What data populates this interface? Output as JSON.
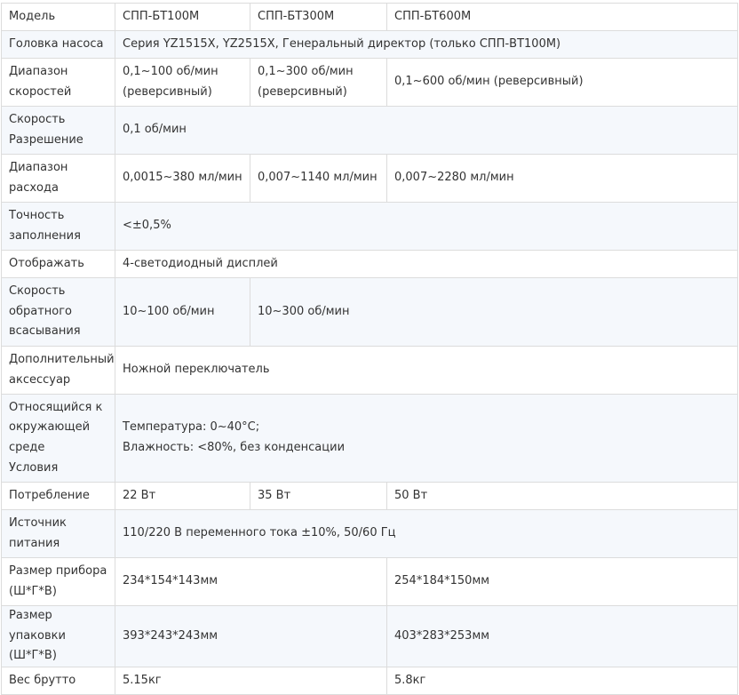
{
  "table": {
    "rows": [
      [
        "Модель",
        "СПП-БТ100М",
        "СПП-БТ300М",
        "СПП-БТ600М"
      ],
      [
        "Головка насоса",
        "Серия YZ1515X, YZ2515X, Генеральный директор (только СПП-ВТ100М)"
      ],
      [
        "Диапазон\nскоростей",
        "0,1~100 об/мин\n(реверсивный)",
        "0,1~300 об/мин\n(реверсивный)",
        "0,1~600 об/мин (реверсивный)"
      ],
      [
        "Скорость\nРазрешение",
        "0,1 об/мин"
      ],
      [
        "Диапазон\nрасхода",
        "0,0015~380 мл/мин",
        "0,007~1140 мл/мин",
        "0,007~2280 мл/мин"
      ],
      [
        "Точность\nзаполнения",
        "<±0,5%"
      ],
      [
        "Отображать",
        "4-светодиодный дисплей"
      ],
      [
        "Скорость\nобратного\nвсасывания",
        "10~100 об/мин",
        "10~300 об/мин"
      ],
      [
        "Дополнительный\nаксессуар",
        "Ножной переключатель"
      ],
      [
        "Относящийся к\nокружающей\nсреде\nУсловия",
        "Температура: 0~40°C;\nВлажность: <80%, без конденсации"
      ],
      [
        "Потребление",
        "22 Вт",
        "35 Вт",
        "50 Вт"
      ],
      [
        "Источник\nпитания",
        "110/220 В переменного тока ±10%, 50/60 Гц"
      ],
      [
        "Размер прибора\n(Ш*Г*В)",
        "234*154*143мм",
        "254*184*150мм"
      ],
      [
        "Размер упаковки\n(Ш*Г*В)",
        "393*243*243мм",
        "403*283*253мм"
      ],
      [
        "Вес брутто",
        "5.15кг",
        "5.8кг"
      ]
    ]
  }
}
